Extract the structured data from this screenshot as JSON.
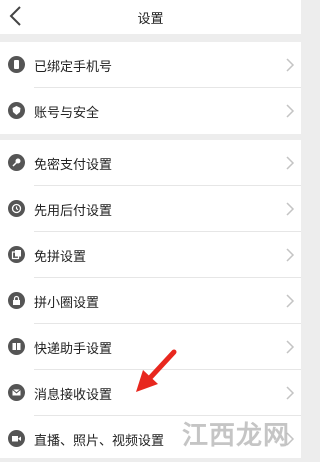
{
  "nav": {
    "title": "设置",
    "back_icon": "chevron-left-icon"
  },
  "group1": [
    {
      "label": "已绑定手机号",
      "icon": "phone-icon"
    },
    {
      "label": "账号与安全",
      "icon": "shield-icon"
    }
  ],
  "group2": [
    {
      "label": "免密支付设置",
      "icon": "key-icon"
    },
    {
      "label": "先用后付设置",
      "icon": "clock-icon"
    },
    {
      "label": "免拼设置",
      "icon": "copy-icon"
    },
    {
      "label": "拼小圈设置",
      "icon": "lock-icon"
    },
    {
      "label": "快递助手设置",
      "icon": "package-icon"
    },
    {
      "label": "消息接收设置",
      "icon": "mail-icon"
    },
    {
      "label": "直播、照片、视频设置",
      "icon": "video-icon"
    }
  ],
  "watermark": "江西龙网",
  "colors": {
    "annotation_arrow": "#e8271e",
    "background": "#ededed"
  }
}
